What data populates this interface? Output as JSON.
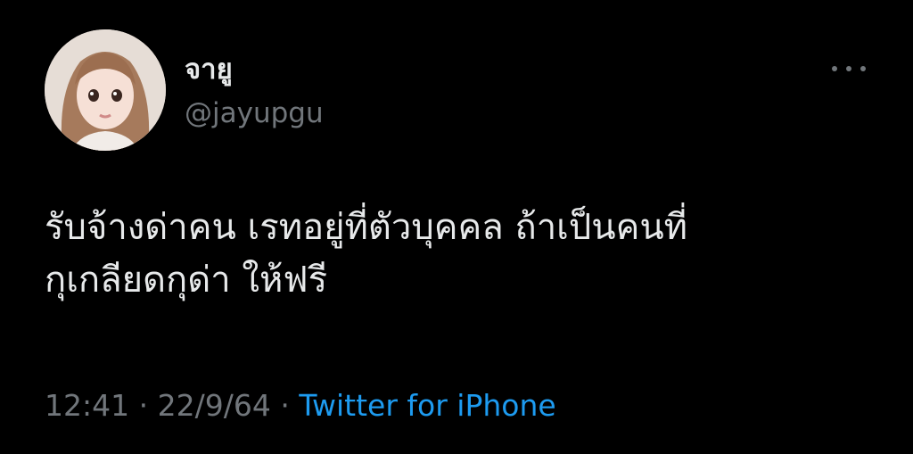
{
  "tweet": {
    "author": {
      "display_name": "จายู",
      "handle": "@jayupgu",
      "avatar_icon": "profile-photo"
    },
    "more_icon": "more-horizontal-icon",
    "text_lines": [
      "รับจ้างด่าคน เรทอยู่ที่ตัวบุคคล ถ้าเป็นคนที่",
      "กุเกลียดกุด่า ให้ฟรี"
    ],
    "meta": {
      "time": "12:41",
      "separator": "·",
      "date": "22/9/64",
      "source": "Twitter for iPhone"
    }
  },
  "colors": {
    "background": "#000000",
    "primary_text": "#e7e9ea",
    "secondary_text": "#71767b",
    "link": "#1d9bf0"
  }
}
